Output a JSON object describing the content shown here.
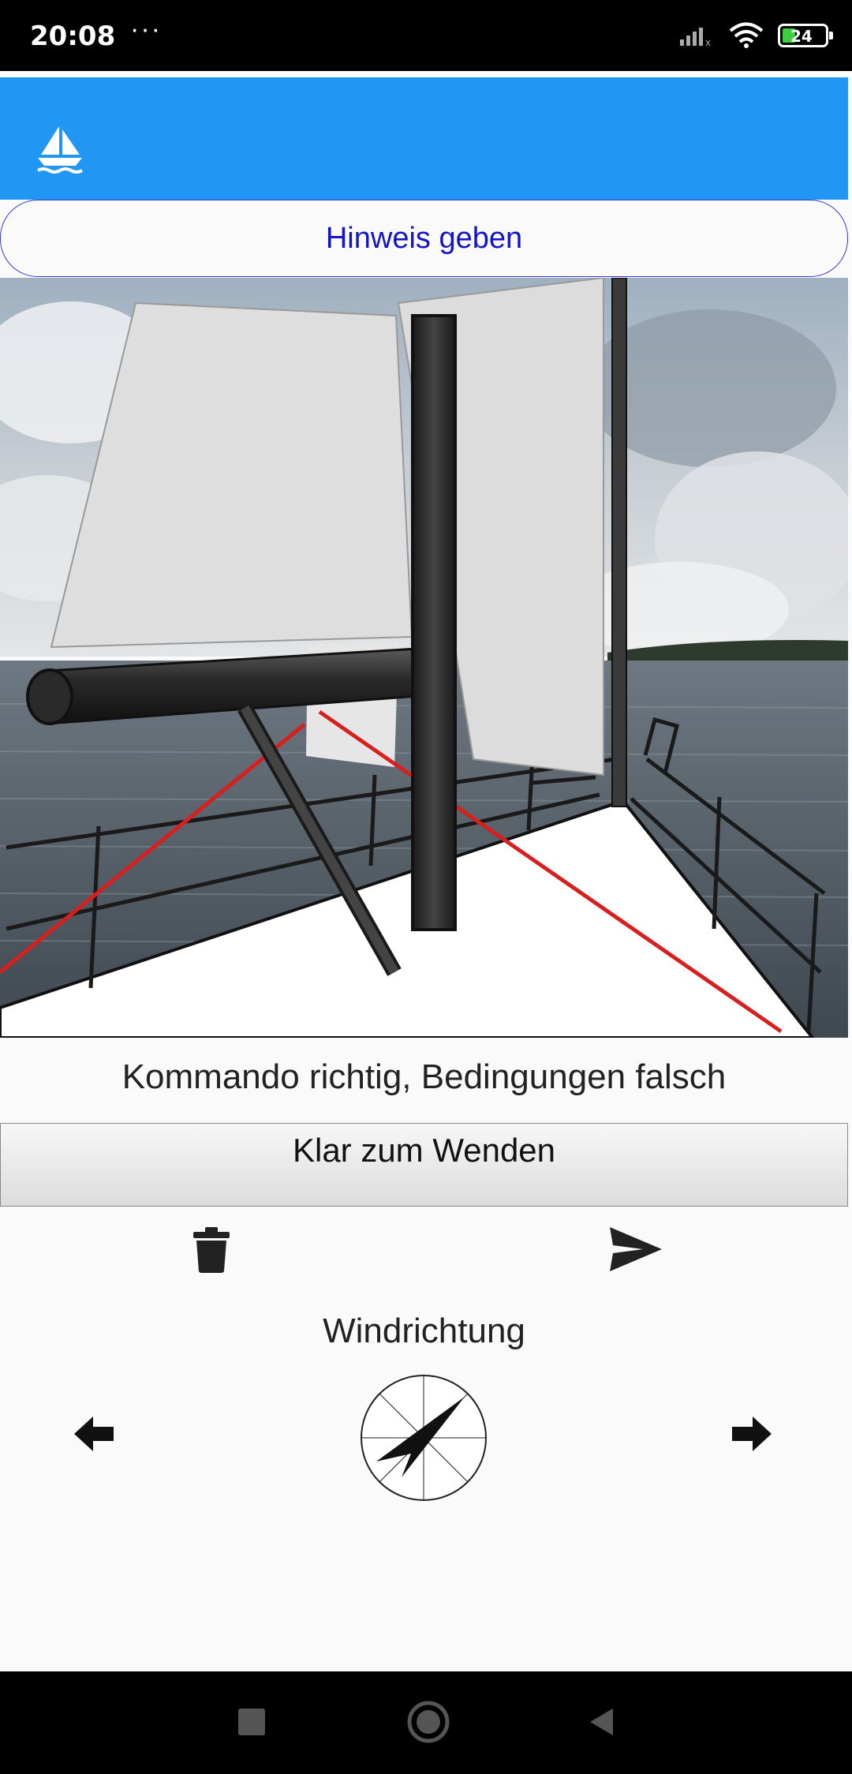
{
  "status_bar": {
    "time": "20:08",
    "dots": "···",
    "battery": "24"
  },
  "hint_button": {
    "label": "Hinweis geben"
  },
  "feedback": {
    "text": "Kommando richtig, Bedingungen falsch"
  },
  "command": {
    "value": "Klar zum Wenden"
  },
  "wind": {
    "label": "Windrichtung"
  },
  "icons": {
    "app_logo": "sailboat-icon",
    "delete": "trash-icon",
    "send": "send-icon",
    "rotate_left": "arrow-left-icon",
    "rotate_right": "arrow-right-icon",
    "compass": "compass-icon"
  },
  "colors": {
    "app_bar": "#2196f3",
    "hint_text": "#1515c8",
    "sheet_lines": "#e02020"
  }
}
